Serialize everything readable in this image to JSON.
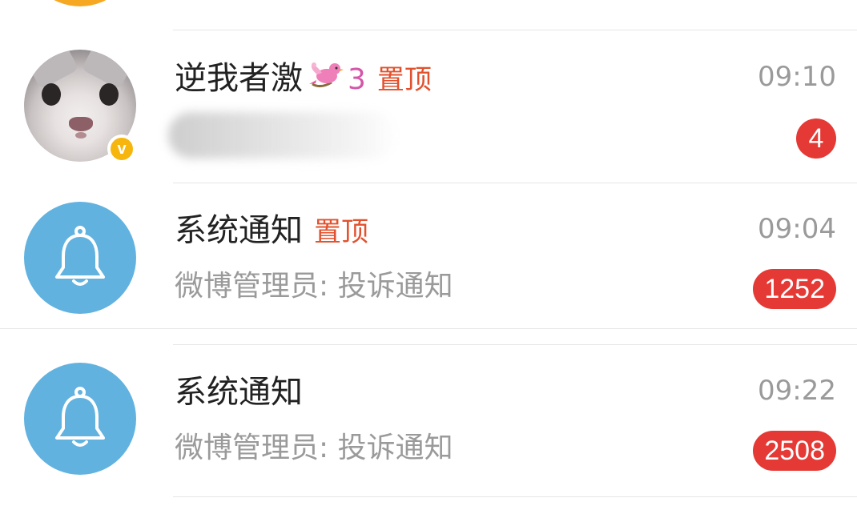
{
  "conversations": [
    {
      "name": "逆我者激",
      "level": "3",
      "pin_label": "置顶",
      "preview": "",
      "time": "09:10",
      "unread": "4",
      "avatar": "cat-photo",
      "vip_badge": "v"
    },
    {
      "name": "系统通知",
      "pin_label": "置顶",
      "preview": "微博管理员: 投诉通知",
      "time": "09:04",
      "unread": "1252",
      "avatar": "bell-icon"
    },
    {
      "name": "系统通知",
      "preview": "微博管理员: 投诉通知",
      "time": "09:22",
      "unread": "2508",
      "avatar": "bell-icon"
    }
  ],
  "colors": {
    "pin": "#e2512d",
    "badge": "#e53935",
    "bell_avatar": "#62b2e0",
    "level": "#d456a8",
    "vip": "#f6b60d"
  }
}
